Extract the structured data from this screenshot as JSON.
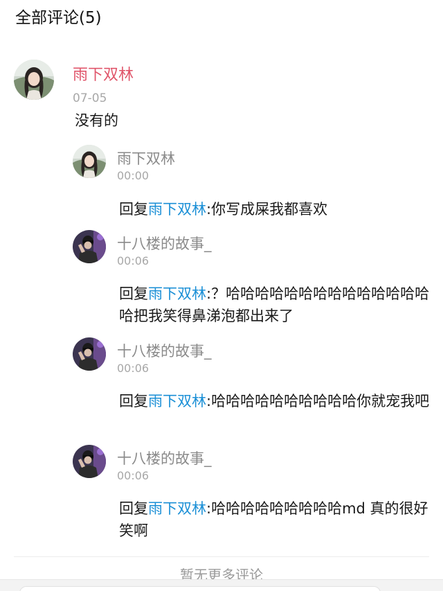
{
  "header": {
    "title": "全部评论(5)"
  },
  "main_comment": {
    "author": "雨下双林",
    "time": "07-05",
    "text": "没有的"
  },
  "replies": [
    {
      "author": "雨下双林",
      "time": "00:00",
      "prefix": "回复",
      "target": "雨下双林",
      "text": ":你写成屎我都喜欢",
      "avatar": "girl-avatar"
    },
    {
      "author": "十八楼的故事_",
      "time": "00:06",
      "prefix": "回复",
      "target": "雨下双林",
      "text": ":？哈哈哈哈哈哈哈哈哈哈哈哈哈哈哈把我笑得鼻涕泡都出来了",
      "avatar": "boy-avatar"
    },
    {
      "author": "十八楼的故事_",
      "time": "00:06",
      "prefix": "回复",
      "target": "雨下双林",
      "text": ":哈哈哈哈哈哈哈哈哈哈你就宠我吧",
      "avatar": "boy-avatar"
    },
    {
      "author": "十八楼的故事_",
      "time": "00:06",
      "prefix": "回复",
      "target": "雨下双林",
      "text": ":哈哈哈哈哈哈哈哈哈md 真的很好笑啊",
      "avatar": "boy-avatar"
    }
  ],
  "footer": {
    "more_label": "暂无更多评论"
  },
  "colors": {
    "author_main": "#e0566b",
    "mention": "#1a8fd6",
    "muted": "#8a8a8a"
  }
}
